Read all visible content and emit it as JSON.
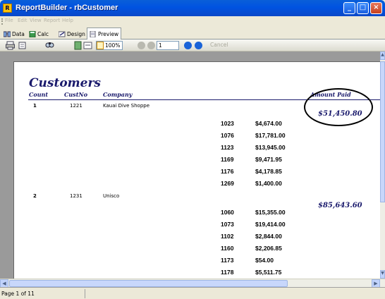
{
  "window": {
    "title": "ReportBuilder - rbCustomer",
    "app_icon_label": "R"
  },
  "menu": [
    {
      "label": "File"
    },
    {
      "label": "Edit"
    },
    {
      "label": "View"
    },
    {
      "label": "Report"
    },
    {
      "label": "Help"
    }
  ],
  "tabs": [
    {
      "label": "Data",
      "active": false
    },
    {
      "label": "Calc",
      "active": false
    },
    {
      "label": "Design",
      "active": false
    },
    {
      "label": "Preview",
      "active": true
    }
  ],
  "toolbar": {
    "zoom": "100%",
    "page": "1",
    "cancel_label": "Cancel"
  },
  "report": {
    "title": "Customers",
    "headers": {
      "count": "Count",
      "custno": "CustNo",
      "company": "Company",
      "amount_paid": "Amount Paid"
    },
    "customers": [
      {
        "count": "1",
        "custno": "1221",
        "company": "Kauai Dive Shoppe",
        "amount_paid": "$51,450.80",
        "orders": [
          {
            "order": "1023",
            "amount": "$4,674.00"
          },
          {
            "order": "1076",
            "amount": "$17,781.00"
          },
          {
            "order": "1123",
            "amount": "$13,945.00"
          },
          {
            "order": "1169",
            "amount": "$9,471.95"
          },
          {
            "order": "1176",
            "amount": "$4,178.85"
          },
          {
            "order": "1269",
            "amount": "$1,400.00"
          }
        ]
      },
      {
        "count": "2",
        "custno": "1231",
        "company": "Unisco",
        "amount_paid": "$85,643.60",
        "orders": [
          {
            "order": "1060",
            "amount": "$15,355.00"
          },
          {
            "order": "1073",
            "amount": "$19,414.00"
          },
          {
            "order": "1102",
            "amount": "$2,844.00"
          },
          {
            "order": "1160",
            "amount": "$2,206.85"
          },
          {
            "order": "1173",
            "amount": "$54.00"
          },
          {
            "order": "1178",
            "amount": "$5,511.75"
          }
        ]
      }
    ]
  },
  "status": {
    "text": "Page 1 of 11"
  },
  "colors": {
    "title_bar": "#0053e1",
    "report_accent": "#1a1a6c",
    "preview_background": "#9a9a9a"
  },
  "icons": [
    "app-icon",
    "data-icon",
    "calc-icon",
    "design-icon",
    "preview-icon",
    "print-icon",
    "find-icon",
    "first-page-icon",
    "prev-page-icon",
    "next-page-icon",
    "last-page-icon"
  ]
}
